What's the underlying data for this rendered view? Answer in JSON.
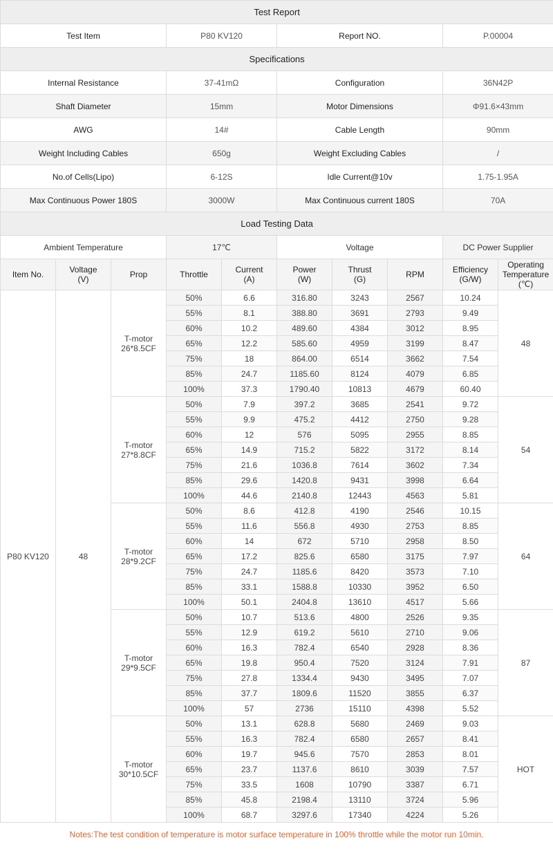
{
  "title": "Test Report",
  "report_info": {
    "test_item_label": "Test Item",
    "test_item_value": "P80 KV120",
    "report_no_label": "Report NO.",
    "report_no_value": "P.00004"
  },
  "specifications": {
    "title": "Specifications",
    "rows": [
      {
        "l1": "Internal Resistance",
        "v1": "37-41mΩ",
        "l2": "Configuration",
        "v2": "36N42P"
      },
      {
        "l1": "Shaft Diameter",
        "v1": "15mm",
        "l2": "Motor Dimensions",
        "v2": "Φ91.6×43mm"
      },
      {
        "l1": "AWG",
        "v1": "14#",
        "l2": "Cable Length",
        "v2": "90mm"
      },
      {
        "l1": "Weight Including Cables",
        "v1": "650g",
        "l2": "Weight Excluding Cables",
        "v2": "/"
      },
      {
        "l1": "No.of Cells(Lipo)",
        "v1": "6-12S",
        "l2": "Idle Current@10v",
        "v2": "1.75-1.95A"
      },
      {
        "l1": "Max Continuous Power 180S",
        "v1": "3000W",
        "l2": "Max Continuous current 180S",
        "v2": "70A"
      }
    ]
  },
  "load_testing": {
    "title": "Load Testing Data",
    "ambient_label": "Ambient Temperature",
    "ambient_value": "17℃",
    "voltage_label": "Voltage",
    "voltage_value": "DC Power Supplier",
    "headers": {
      "item_no": "Item No.",
      "voltage": "Voltage\n(V)",
      "prop": "Prop",
      "throttle": "Throttle",
      "current": "Current\n(A)",
      "power": "Power\n(W)",
      "thrust": "Thrust\n(G)",
      "rpm": "RPM",
      "efficiency": "Efficiency\n(G/W)",
      "op_temp": "Operating\nTemperature\n(℃)"
    },
    "item_no": "P80 KV120",
    "voltage": "48",
    "props": [
      {
        "name": "T-motor\n26*8.5CF",
        "temp": "48",
        "hot": false,
        "rows": [
          [
            "50%",
            "6.6",
            "316.80",
            "3243",
            "2567",
            "10.24"
          ],
          [
            "55%",
            "8.1",
            "388.80",
            "3691",
            "2793",
            "9.49"
          ],
          [
            "60%",
            "10.2",
            "489.60",
            "4384",
            "3012",
            "8.95"
          ],
          [
            "65%",
            "12.2",
            "585.60",
            "4959",
            "3199",
            "8.47"
          ],
          [
            "75%",
            "18",
            "864.00",
            "6514",
            "3662",
            "7.54"
          ],
          [
            "85%",
            "24.7",
            "1185.60",
            "8124",
            "4079",
            "6.85"
          ],
          [
            "100%",
            "37.3",
            "1790.40",
            "10813",
            "4679",
            "60.40"
          ]
        ]
      },
      {
        "name": "T-motor\n27*8.8CF",
        "temp": "54",
        "hot": false,
        "rows": [
          [
            "50%",
            "7.9",
            "397.2",
            "3685",
            "2541",
            "9.72"
          ],
          [
            "55%",
            "9.9",
            "475.2",
            "4412",
            "2750",
            "9.28"
          ],
          [
            "60%",
            "12",
            "576",
            "5095",
            "2955",
            "8.85"
          ],
          [
            "65%",
            "14.9",
            "715.2",
            "5822",
            "3172",
            "8.14"
          ],
          [
            "75%",
            "21.6",
            "1036.8",
            "7614",
            "3602",
            "7.34"
          ],
          [
            "85%",
            "29.6",
            "1420.8",
            "9431",
            "3998",
            "6.64"
          ],
          [
            "100%",
            "44.6",
            "2140.8",
            "12443",
            "4563",
            "5.81"
          ]
        ]
      },
      {
        "name": "T-motor\n28*9.2CF",
        "temp": "64",
        "hot": false,
        "rows": [
          [
            "50%",
            "8.6",
            "412.8",
            "4190",
            "2546",
            "10.15"
          ],
          [
            "55%",
            "11.6",
            "556.8",
            "4930",
            "2753",
            "8.85"
          ],
          [
            "60%",
            "14",
            "672",
            "5710",
            "2958",
            "8.50"
          ],
          [
            "65%",
            "17.2",
            "825.6",
            "6580",
            "3175",
            "7.97"
          ],
          [
            "75%",
            "24.7",
            "1185.6",
            "8420",
            "3573",
            "7.10"
          ],
          [
            "85%",
            "33.1",
            "1588.8",
            "10330",
            "3952",
            "6.50"
          ],
          [
            "100%",
            "50.1",
            "2404.8",
            "13610",
            "4517",
            "5.66"
          ]
        ]
      },
      {
        "name": "T-motor\n29*9.5CF",
        "temp": "87",
        "hot": false,
        "rows": [
          [
            "50%",
            "10.7",
            "513.6",
            "4800",
            "2526",
            "9.35"
          ],
          [
            "55%",
            "12.9",
            "619.2",
            "5610",
            "2710",
            "9.06"
          ],
          [
            "60%",
            "16.3",
            "782.4",
            "6540",
            "2928",
            "8.36"
          ],
          [
            "65%",
            "19.8",
            "950.4",
            "7520",
            "3124",
            "7.91"
          ],
          [
            "75%",
            "27.8",
            "1334.4",
            "9430",
            "3495",
            "7.07"
          ],
          [
            "85%",
            "37.7",
            "1809.6",
            "11520",
            "3855",
            "6.37"
          ],
          [
            "100%",
            "57",
            "2736",
            "15110",
            "4398",
            "5.52"
          ]
        ]
      },
      {
        "name": "T-motor\n30*10.5CF",
        "temp": "HOT",
        "hot": true,
        "rows": [
          [
            "50%",
            "13.1",
            "628.8",
            "5680",
            "2469",
            "9.03"
          ],
          [
            "55%",
            "16.3",
            "782.4",
            "6580",
            "2657",
            "8.41"
          ],
          [
            "60%",
            "19.7",
            "945.6",
            "7570",
            "2853",
            "8.01"
          ],
          [
            "65%",
            "23.7",
            "1137.6",
            "8610",
            "3039",
            "7.57"
          ],
          [
            "75%",
            "33.5",
            "1608",
            "10790",
            "3387",
            "6.71"
          ],
          [
            "85%",
            "45.8",
            "2198.4",
            "13110",
            "3724",
            "5.96"
          ],
          [
            "100%",
            "68.7",
            "3297.6",
            "17340",
            "4224",
            "5.26"
          ]
        ]
      }
    ]
  },
  "note": "Notes:The test condition of temperature is motor surface temperature in 100% throttle while the motor run 10min.",
  "colors": {
    "hot": "#e0161c",
    "note": "#e8632f",
    "section_bg": "#eeeeee"
  }
}
